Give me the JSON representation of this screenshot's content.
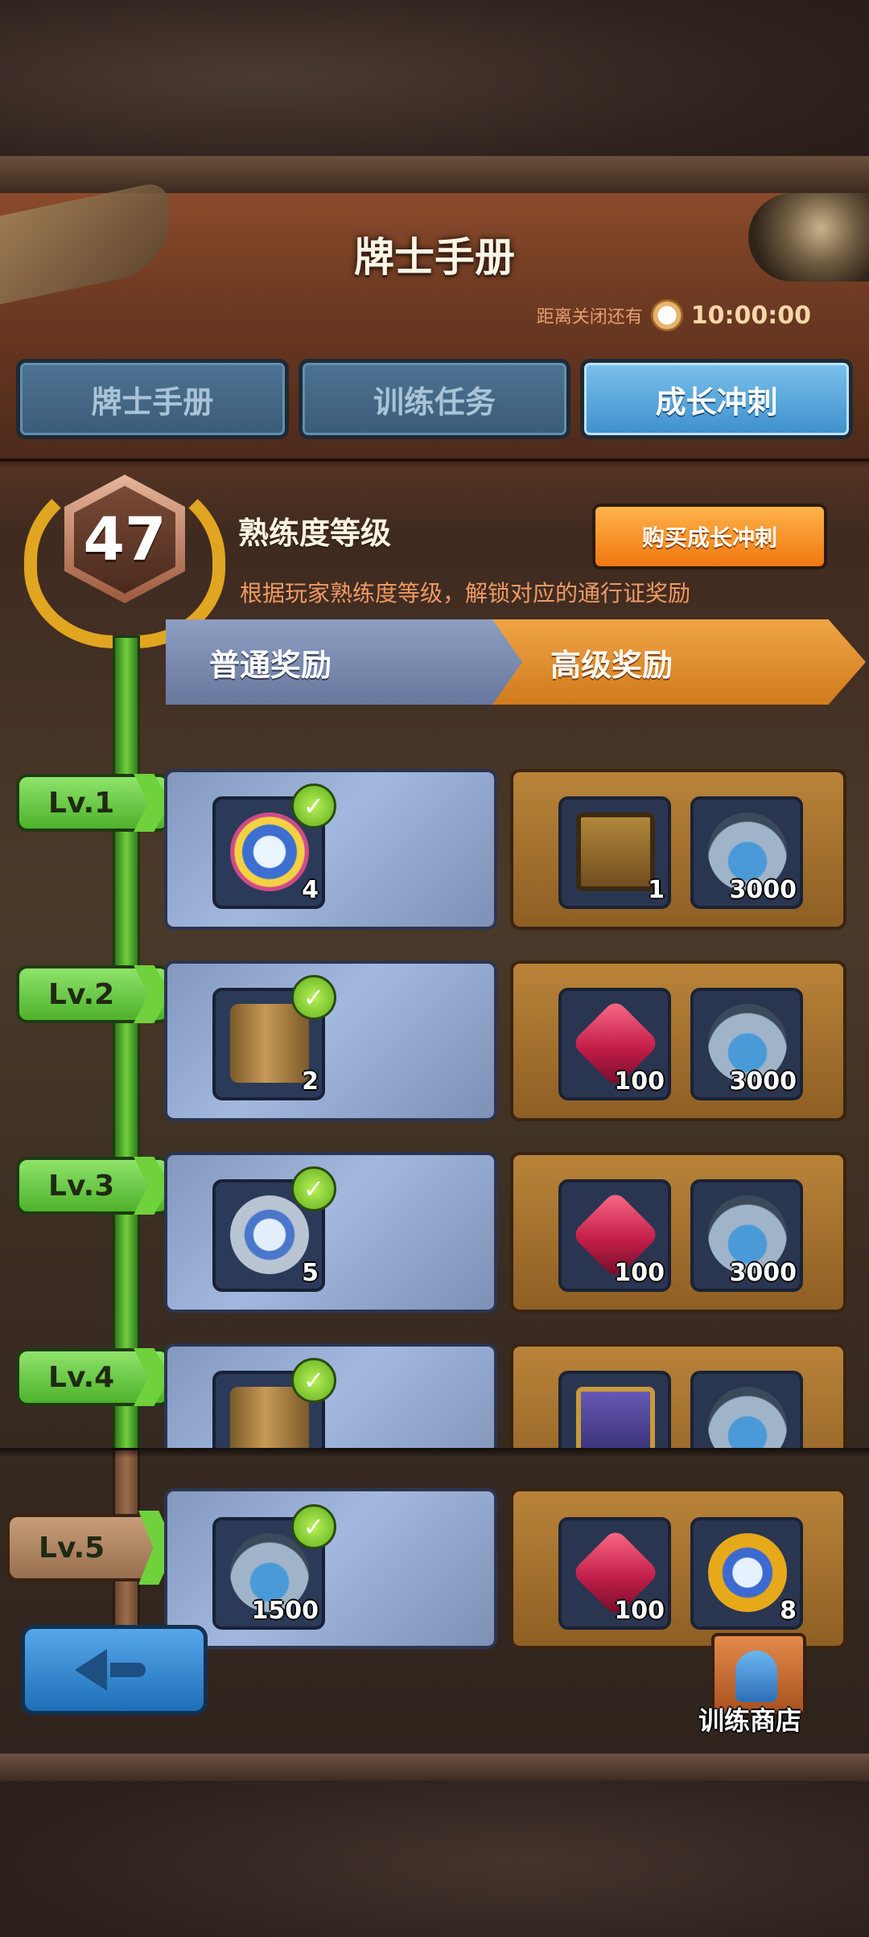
{
  "header": {
    "title": "牌士手册",
    "countdown_label": "距离关闭还有",
    "countdown_time": "10:00:00"
  },
  "tabs": [
    {
      "label": "牌士手册",
      "active": false
    },
    {
      "label": "训练任务",
      "active": false
    },
    {
      "label": "成长冲刺",
      "active": true
    }
  ],
  "level": {
    "value": "47",
    "title": "熟练度等级",
    "description": "根据玩家熟练度等级，解锁对应的通行证奖励",
    "buy_label": "购买成长冲刺"
  },
  "tracks": {
    "normal_label": "普通奖励",
    "premium_label": "高级奖励"
  },
  "rows": [
    {
      "level": "Lv.1",
      "normal": {
        "icon": "rainbow-orb-icon",
        "count": "4",
        "claimed": true
      },
      "premium": [
        {
          "icon": "star-card-icon",
          "count": "1"
        },
        {
          "icon": "water-jar-icon",
          "count": "3000"
        }
      ]
    },
    {
      "level": "Lv.2",
      "normal": {
        "icon": "scroll-pack-icon",
        "count": "2",
        "claimed": true
      },
      "premium": [
        {
          "icon": "red-gem-icon",
          "count": "100"
        },
        {
          "icon": "water-jar-icon",
          "count": "3000"
        }
      ]
    },
    {
      "level": "Lv.3",
      "normal": {
        "icon": "silver-orb-icon",
        "count": "5",
        "claimed": true
      },
      "premium": [
        {
          "icon": "red-gem-icon",
          "count": "100"
        },
        {
          "icon": "water-jar-icon",
          "count": "3000"
        }
      ]
    },
    {
      "level": "Lv.4",
      "normal": {
        "icon": "scroll-pack-icon",
        "count": "",
        "claimed": true
      },
      "premium": [
        {
          "icon": "deck-pack-icon",
          "count": ""
        },
        {
          "icon": "water-jar-icon",
          "count": ""
        }
      ]
    },
    {
      "level": "Lv.5",
      "normal": {
        "icon": "water-jar-icon",
        "count": "1500",
        "claimed": true
      },
      "premium": [
        {
          "icon": "red-gem-icon",
          "count": "100"
        },
        {
          "icon": "gold-orb-icon",
          "count": "8"
        }
      ]
    }
  ],
  "footer": {
    "shop_label": "训练商店"
  }
}
